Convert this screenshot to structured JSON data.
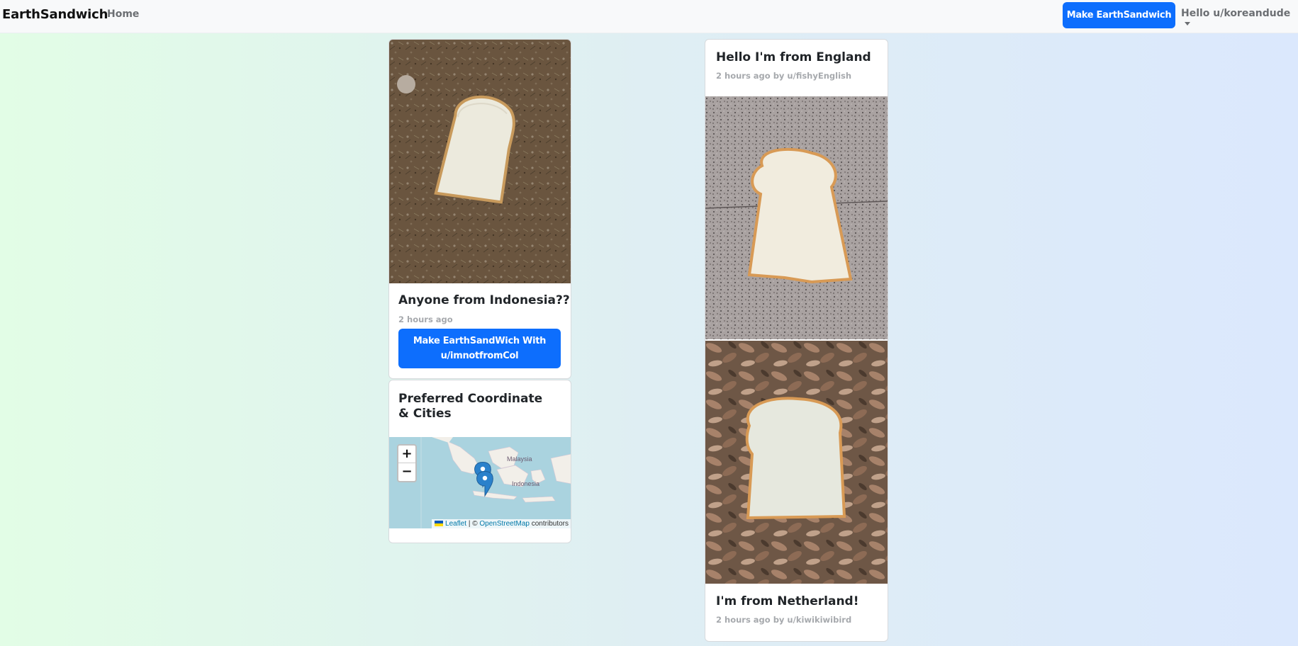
{
  "navbar": {
    "brand": "EarthSandwich",
    "home_label": "Home",
    "make_button_label": "Make EarthSandwich",
    "user_greeting": "Hello u/koreandude"
  },
  "post_indonesia": {
    "title": "Anyone from Indonesia??",
    "meta": "2 hours ago",
    "cta_label": "Make EarthSandWich With u/imnotfromCol"
  },
  "preferred_card": {
    "title": "Preferred Coordinate & Cities",
    "map": {
      "zoom_in": "+",
      "zoom_out": "−",
      "labels": [
        "Malaysia",
        "Indonesia"
      ],
      "attribution": {
        "leaflet": "Leaflet",
        "separator": " | © ",
        "osm": "OpenStreetMap",
        "suffix": " contributors"
      }
    }
  },
  "post_england": {
    "title": "Hello I'm from England",
    "meta": "2 hours ago by u/fishyEnglish"
  },
  "post_netherland": {
    "title": "I'm from Netherland!",
    "meta": "2 hours ago by u/kiwikiwibird"
  },
  "colors": {
    "primary": "#0d6efd",
    "navbar_bg": "#f8f9fa",
    "map_water": "#aad3df",
    "marker": "#2a81cb"
  }
}
